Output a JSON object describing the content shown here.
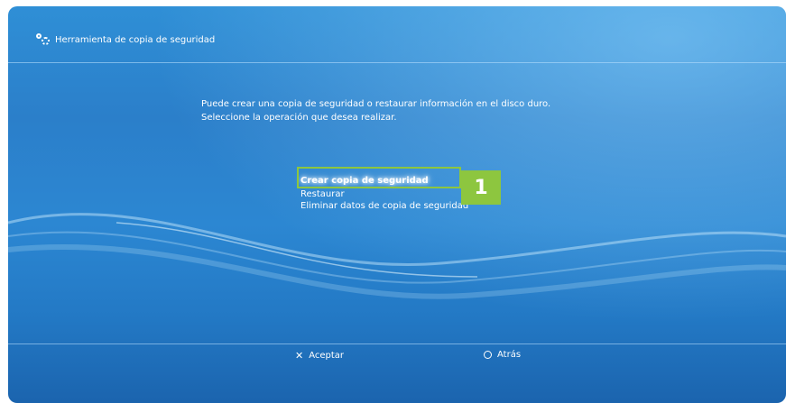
{
  "header": {
    "title": "Herramienta de copia de seguridad",
    "icon": "tools-icon"
  },
  "message": {
    "line1": "Puede crear una copia de seguridad o restaurar información en el disco duro.",
    "line2": "Seleccione la operación que desea realizar."
  },
  "menu": {
    "items": [
      {
        "label": "Crear copia de seguridad",
        "selected": true
      },
      {
        "label": "Restaurar",
        "selected": false
      },
      {
        "label": "Eliminar datos de copia de seguridad",
        "selected": false
      }
    ]
  },
  "callout": {
    "number": "1",
    "color": "#8dc63f"
  },
  "footer": {
    "accept_label": "Aceptar",
    "back_label": "Atrás",
    "accept_icon": "cross-icon",
    "back_icon": "circle-icon"
  },
  "colors": {
    "background": "#2b7fca",
    "highlight": "#8dc63f",
    "text": "#ffffff"
  }
}
